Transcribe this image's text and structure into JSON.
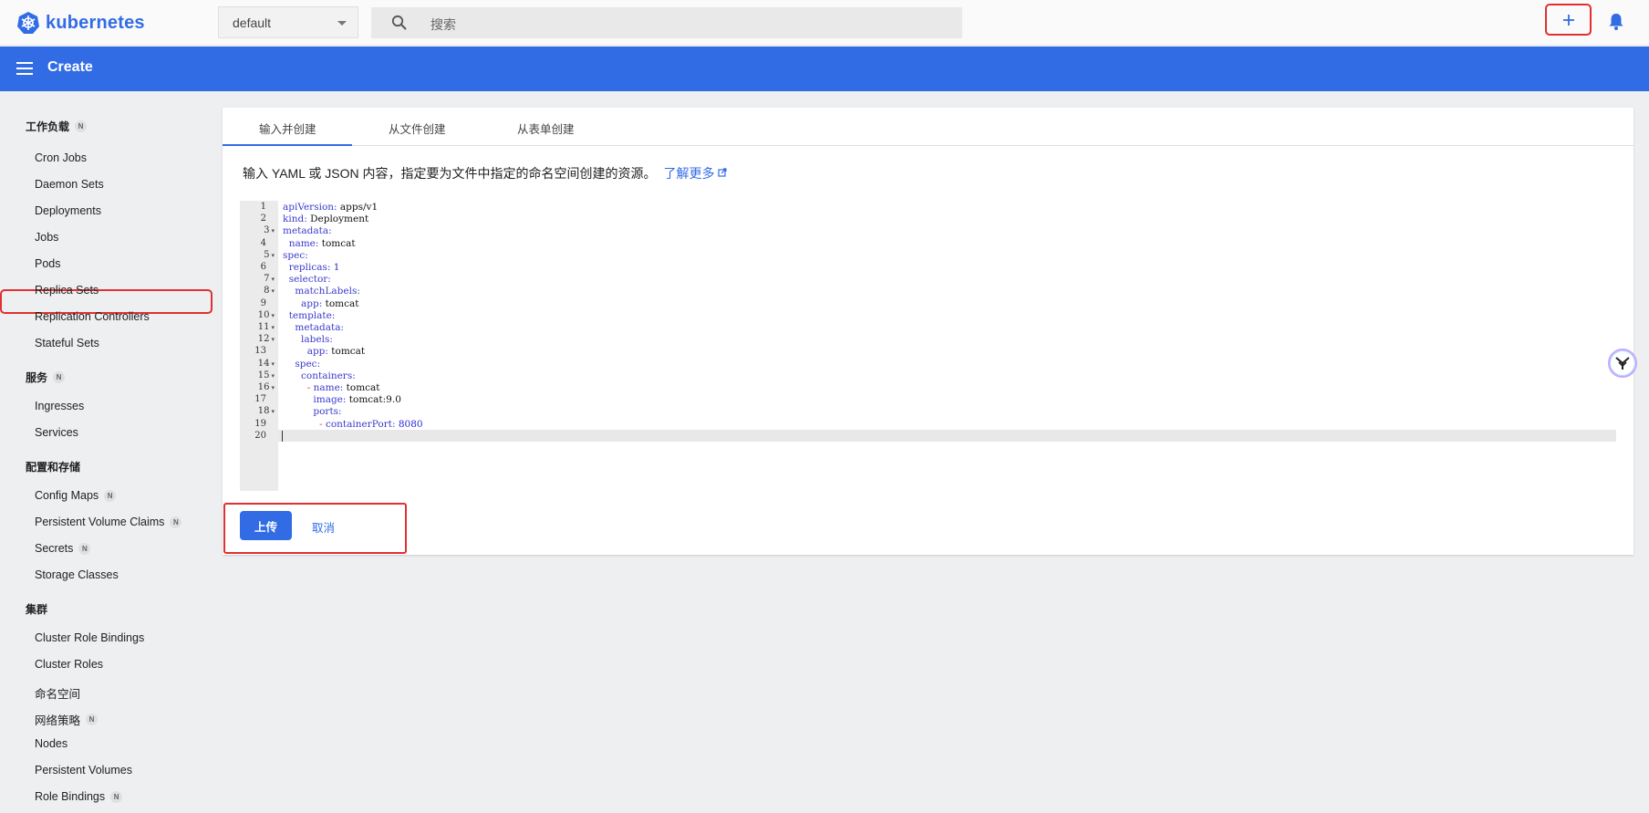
{
  "topbar": {
    "logo_text": "kubernetes",
    "namespace_value": "default",
    "search_placeholder": "搜索"
  },
  "appbar": {
    "title": "Create"
  },
  "sidebar": {
    "sections": [
      {
        "title": "工作负载",
        "badge": "N",
        "items": [
          {
            "label": "Cron Jobs"
          },
          {
            "label": "Daemon Sets"
          },
          {
            "label": "Deployments"
          },
          {
            "label": "Jobs"
          },
          {
            "label": "Pods"
          },
          {
            "label": "Replica Sets"
          },
          {
            "label": "Replication Controllers"
          },
          {
            "label": "Stateful Sets"
          }
        ]
      },
      {
        "title": "服务",
        "badge": "N",
        "items": [
          {
            "label": "Ingresses"
          },
          {
            "label": "Services"
          }
        ]
      },
      {
        "title": "配置和存储",
        "items": [
          {
            "label": "Config Maps",
            "badge": "N"
          },
          {
            "label": "Persistent Volume Claims",
            "badge": "N"
          },
          {
            "label": "Secrets",
            "badge": "N"
          },
          {
            "label": "Storage Classes"
          }
        ]
      },
      {
        "title": "集群",
        "items": [
          {
            "label": "Cluster Role Bindings"
          },
          {
            "label": "Cluster Roles"
          },
          {
            "label": "命名空间"
          },
          {
            "label": "网络策略",
            "badge": "N"
          },
          {
            "label": "Nodes"
          },
          {
            "label": "Persistent Volumes"
          },
          {
            "label": "Role Bindings",
            "badge": "N"
          }
        ]
      }
    ]
  },
  "main": {
    "tabs": [
      {
        "label": "输入并创建",
        "active": true
      },
      {
        "label": "从文件创建"
      },
      {
        "label": "从表单创建"
      }
    ],
    "description": "输入 YAML 或 JSON 内容，指定要为文件中指定的命名空间创建的资源。",
    "learn_more": "了解更多",
    "code_lines": [
      "apiVersion: apps/v1",
      "kind: Deployment",
      "metadata:",
      "  name: tomcat",
      "spec:",
      "  replicas: 1",
      "  selector:",
      "    matchLabels:",
      "      app: tomcat",
      "  template:",
      "    metadata:",
      "      labels:",
      "        app: tomcat",
      "    spec:",
      "      containers:",
      "        - name: tomcat",
      "          image: tomcat:9.0",
      "          ports:",
      "            - containerPort: 8080",
      ""
    ],
    "upload_label": "上传",
    "cancel_label": "取消"
  },
  "colors": {
    "brand": "#326ce5",
    "highlight": "#e03030"
  }
}
